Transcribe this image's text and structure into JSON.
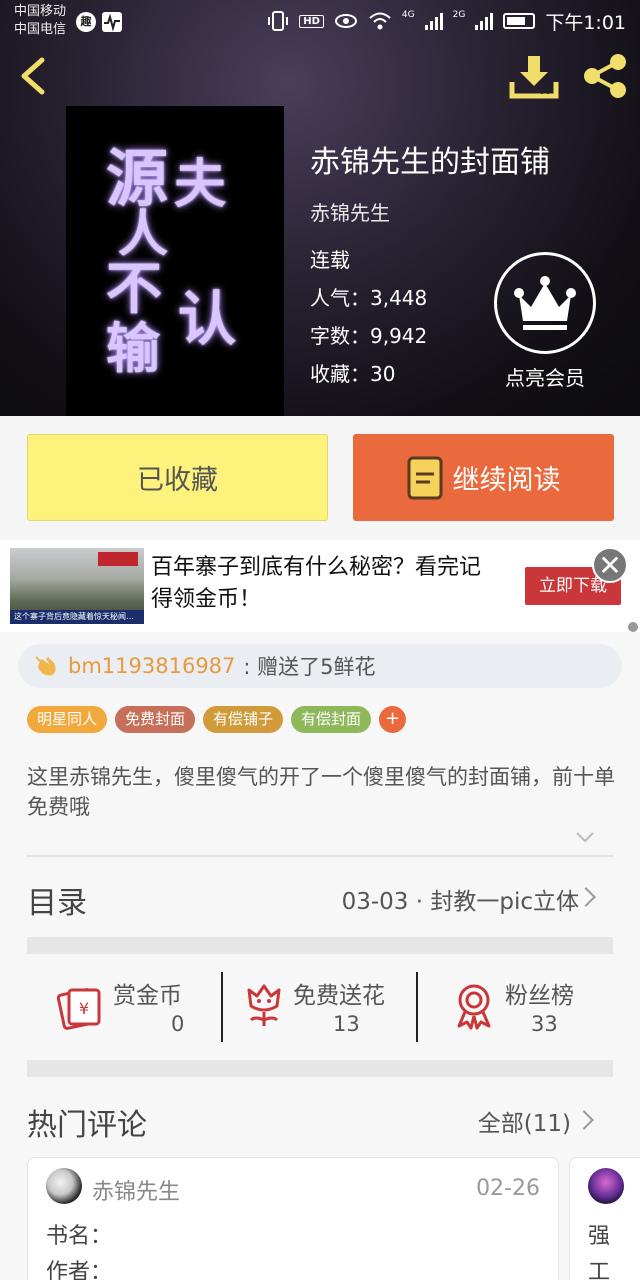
{
  "status_bar": {
    "carrier_1": "中国移动",
    "carrier_2": "中国电信",
    "app_badge": "趣",
    "hd": "HD",
    "net_1": "4G",
    "net_2": "2G",
    "time": "下午1:01"
  },
  "book": {
    "title": "赤锦先生的封面铺",
    "author": "赤锦先生",
    "status": "连载",
    "popularity": "人气：3,448",
    "word_count": "字数：9,942",
    "favorites": "收藏：30",
    "cover_text": [
      "源",
      "夫",
      "人",
      "不",
      "输",
      "认"
    ],
    "vip_label": "点亮会员"
  },
  "actions": {
    "favorited_label": "已收藏",
    "continue_label": "继续阅读"
  },
  "ad": {
    "text": "百年寨子到底有什么秘密？看完记得领金币！",
    "button": "立即下载",
    "image_caption": "这个寨子背后竟隐藏着惊天秘闻…",
    "close": "✕"
  },
  "gift": {
    "user": "bm1193816987",
    "message": ": 赠送了5鲜花"
  },
  "tags": [
    {
      "label": "明星同人",
      "color": "#f1a93d"
    },
    {
      "label": "免费封面",
      "color": "#c6705a"
    },
    {
      "label": "有偿铺子",
      "color": "#d19b3b"
    },
    {
      "label": "有偿封面",
      "color": "#8fb85a"
    }
  ],
  "tag_add": "+",
  "description": "这里赤锦先生，傻里傻气的开了一个傻里傻气的封面铺，前十单免费哦",
  "toc": {
    "label": "目录",
    "latest": "03-03 · 封教一pic立体"
  },
  "stats": [
    {
      "label": "赏金币",
      "value": "0",
      "icon": "coin-envelope-icon"
    },
    {
      "label": "免费送花",
      "value": "13",
      "icon": "flower-icon"
    },
    {
      "label": "粉丝榜",
      "value": "33",
      "icon": "medal-icon"
    }
  ],
  "hot_comments": {
    "label": "热门评论",
    "all": "全部(11)",
    "first": {
      "user": "赤锦先生",
      "date": "02-26",
      "line1": "书名：",
      "line2": "作者："
    },
    "second_partial": {
      "line1": "强",
      "line2": "工"
    }
  },
  "colors": {
    "accent_orange": "#ea6a3d",
    "fav_yellow": "#fdf37c",
    "gift_user": "#e89a3c",
    "icon_red": "#c9373a"
  }
}
